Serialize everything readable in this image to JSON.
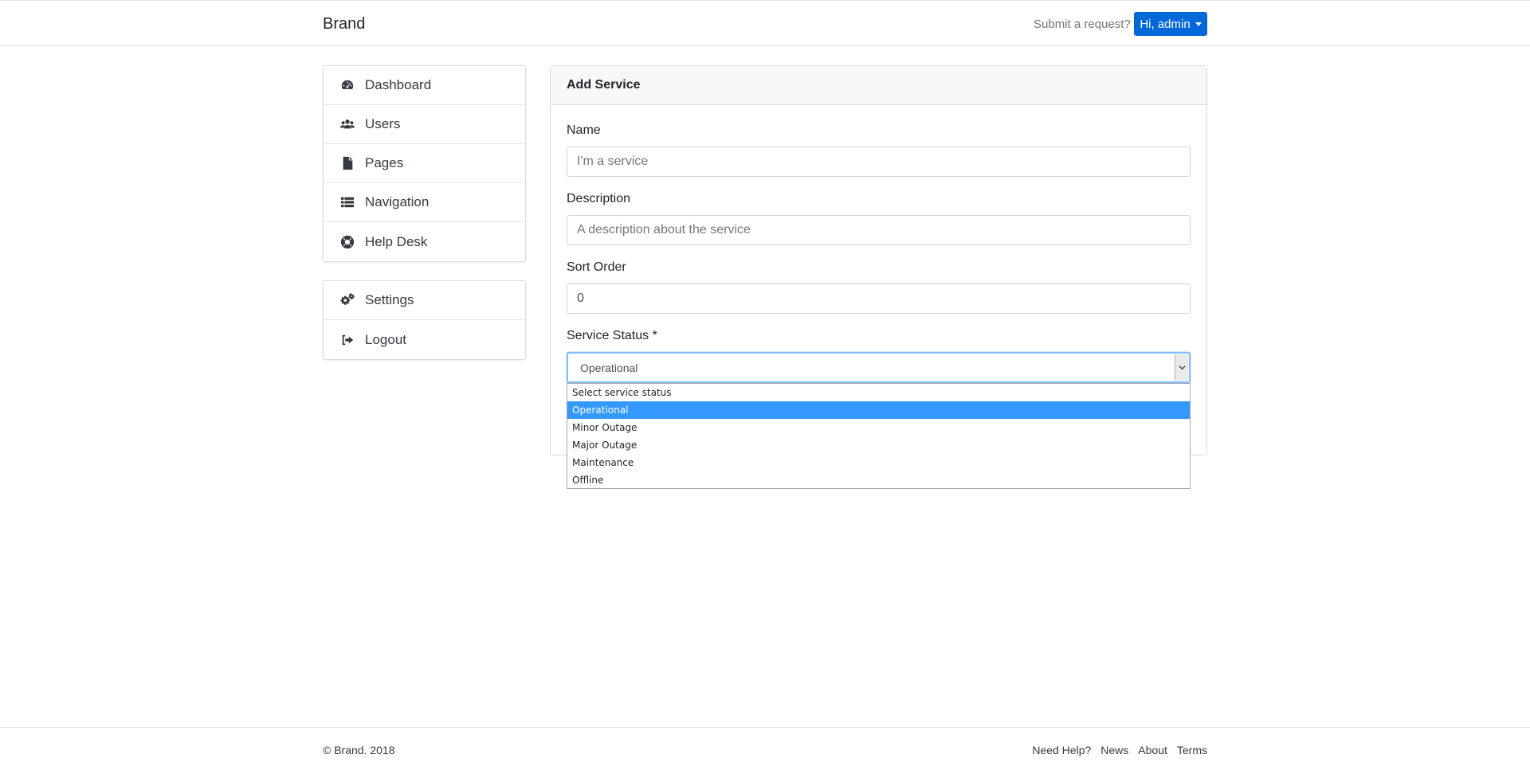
{
  "navbar": {
    "brand": "Brand",
    "submit_link": "Submit a request?",
    "user_button": "Hi, admin"
  },
  "sidebar": {
    "main_items": [
      {
        "label": "Dashboard",
        "icon": "dashboard-icon"
      },
      {
        "label": "Users",
        "icon": "users-icon"
      },
      {
        "label": "Pages",
        "icon": "file-icon"
      },
      {
        "label": "Navigation",
        "icon": "list-icon"
      },
      {
        "label": "Help Desk",
        "icon": "life-ring-icon"
      }
    ],
    "secondary_items": [
      {
        "label": "Settings",
        "icon": "cogs-icon"
      },
      {
        "label": "Logout",
        "icon": "sign-out-icon"
      }
    ]
  },
  "form": {
    "title": "Add Service",
    "name_label": "Name",
    "name_placeholder": "I'm a service",
    "description_label": "Description",
    "description_placeholder": "A description about the service",
    "sort_label": "Sort Order",
    "sort_value": "0",
    "status_label": "Service Status *",
    "status_selected": "Operational",
    "status_options": [
      "Select service status",
      "Operational",
      "Minor Outage",
      "Major Outage",
      "Maintenance",
      "Offline"
    ]
  },
  "footer": {
    "copyright": "© Brand. 2018",
    "links": [
      "Need Help?",
      "News",
      "About",
      "Terms"
    ]
  },
  "colors": {
    "primary_button": "#0069d9",
    "selected_option": "#3399ff",
    "focus_border": "#80bdff"
  }
}
